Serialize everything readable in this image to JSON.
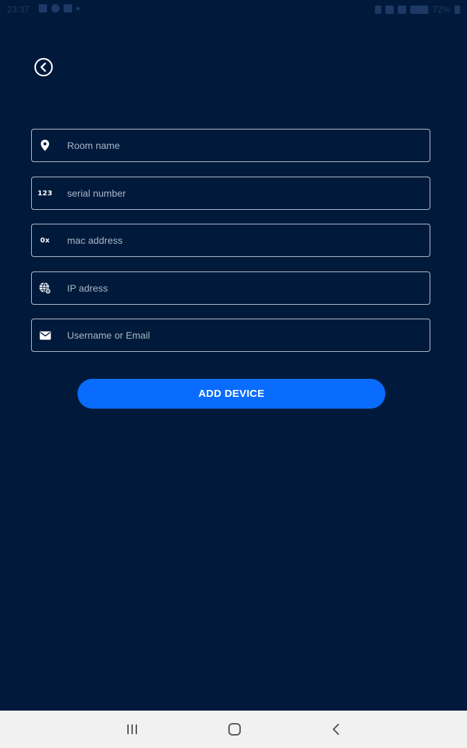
{
  "status_bar": {
    "time": "23:37",
    "battery": "72%"
  },
  "header": {
    "back_icon": "chevron-left-circle-icon"
  },
  "form": {
    "fields": [
      {
        "icon": "location-pin-icon",
        "placeholder": "Room name",
        "value": ""
      },
      {
        "icon": "numeric-123-icon",
        "icon_text": "123",
        "placeholder": "serial number",
        "value": ""
      },
      {
        "icon": "hex-0x-icon",
        "icon_text": "0x",
        "placeholder": "mac address",
        "value": ""
      },
      {
        "icon": "globe-settings-icon",
        "placeholder": "IP adress",
        "value": ""
      },
      {
        "icon": "envelope-icon",
        "placeholder": "Username or Email",
        "value": ""
      }
    ],
    "submit_label": "ADD DEVICE"
  },
  "colors": {
    "background": "#011a3c",
    "accent": "#0a6cff",
    "field_border": "#b9c4d4",
    "navbar": "#f1f1f1"
  },
  "nav_bar": {
    "items": [
      "recent-apps-icon",
      "home-icon",
      "back-icon"
    ]
  }
}
